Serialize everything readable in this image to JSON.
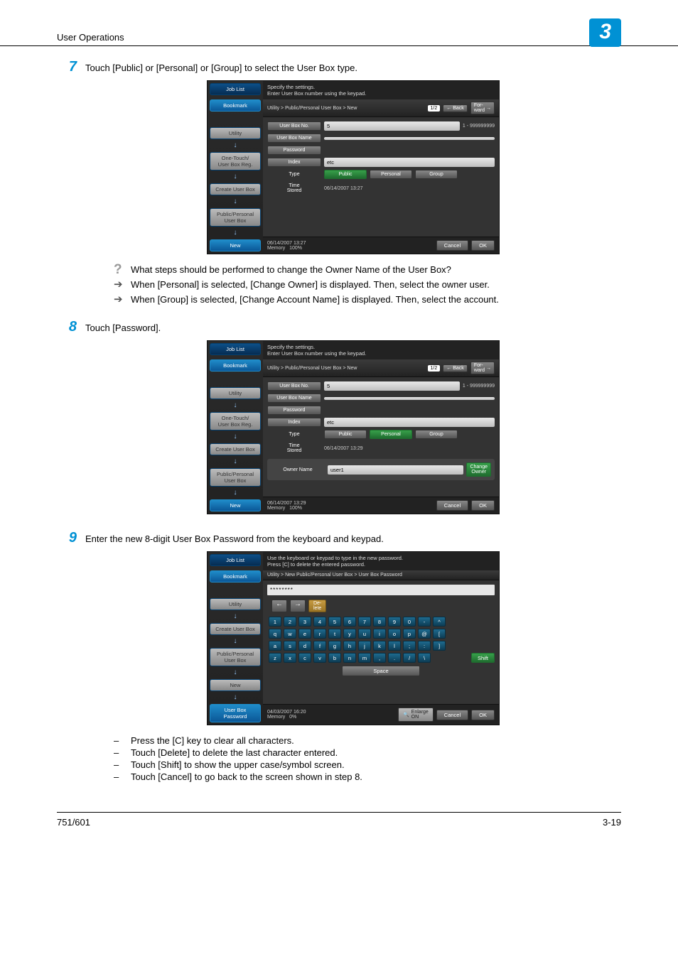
{
  "header": {
    "title": "User Operations",
    "chapter": "3"
  },
  "steps": {
    "s7": {
      "num": "7",
      "text": "Touch [Public] or [Personal] or [Group] to select the User Box type."
    },
    "s8": {
      "num": "8",
      "text": "Touch [Password]."
    },
    "s9": {
      "num": "9",
      "text": "Enter the new 8-digit User Box Password from the keyboard and keypad."
    }
  },
  "qa": {
    "q": "What steps should be performed to change the Owner Name of the User Box?",
    "a1": "When [Personal] is selected, [Change Owner] is displayed. Then, select the owner user.",
    "a2": "When [Group] is selected, [Change Account Name] is displayed. Then, select the account."
  },
  "notes": {
    "n1": "Press the [C] key to clear all characters.",
    "n2": "Touch [Delete] to delete the last character entered.",
    "n3": "Touch [Shift] to show the upper case/symbol screen.",
    "n4": "Touch [Cancel] to go back to the screen shown in step 8."
  },
  "screens": {
    "nav": {
      "job": "Job List",
      "bookmark": "Bookmark",
      "utility": "Utility",
      "onetouch": "One-Touch/\nUser Box Reg.",
      "create": "Create User Box",
      "pp": "Public/Personal\nUser Box",
      "new": "New",
      "password": "User Box\nPassword"
    },
    "common": {
      "hint": "Specify the settings.\nEnter User Box number using the keypad.",
      "crumb": "Utility > Public/Personal User Box > New",
      "page": "1/2",
      "back": "Back",
      "forward": "For-\nward",
      "fld_boxno": "User Box No.",
      "val_boxno": "5",
      "range": "1 - 999999999",
      "fld_boxname": "User Box Name",
      "fld_password": "Password",
      "fld_index": "Index",
      "val_index": "etc",
      "fld_type": "Type",
      "type_public": "Public",
      "type_personal": "Personal",
      "type_group": "Group",
      "fld_time": "Time\nStored",
      "cancel": "Cancel",
      "ok": "OK",
      "memory": "Memory",
      "mem_pct": "100%"
    },
    "s7": {
      "time_stored": "06/14/2007  13:27",
      "footer_dt": "06/14/2007    13:27"
    },
    "s8": {
      "time_stored": "06/14/2007  13:29",
      "footer_dt": "06/14/2007    13:29",
      "owner_label": "Owner Name",
      "owner_val": "user1",
      "change_owner": "Change\nOwner"
    },
    "s9": {
      "hint": "Use the keyboard or keypad to type in the new password.\nPress [C] to delete the entered password.",
      "crumb": "Utility > New Public/Personal User Box > User Box Password",
      "display": "********",
      "delete": "De-\nlete",
      "shift": "Shift",
      "space": "Space",
      "enlarge": "Enlarge\nON",
      "footer_dt": "04/03/2007    16:20",
      "mem_pct": "0%",
      "row1": [
        "1",
        "2",
        "3",
        "4",
        "5",
        "6",
        "7",
        "8",
        "9",
        "0",
        "-",
        "^"
      ],
      "row2": [
        "q",
        "w",
        "e",
        "r",
        "t",
        "y",
        "u",
        "i",
        "o",
        "p",
        "@",
        "["
      ],
      "row3": [
        "a",
        "s",
        "d",
        "f",
        "g",
        "h",
        "j",
        "k",
        "l",
        ";",
        ":",
        "]"
      ],
      "row4": [
        "z",
        "x",
        "c",
        "v",
        "b",
        "n",
        "m",
        ",",
        ".",
        "/",
        "\\"
      ]
    }
  },
  "footer": {
    "left": "751/601",
    "right": "3-19"
  }
}
